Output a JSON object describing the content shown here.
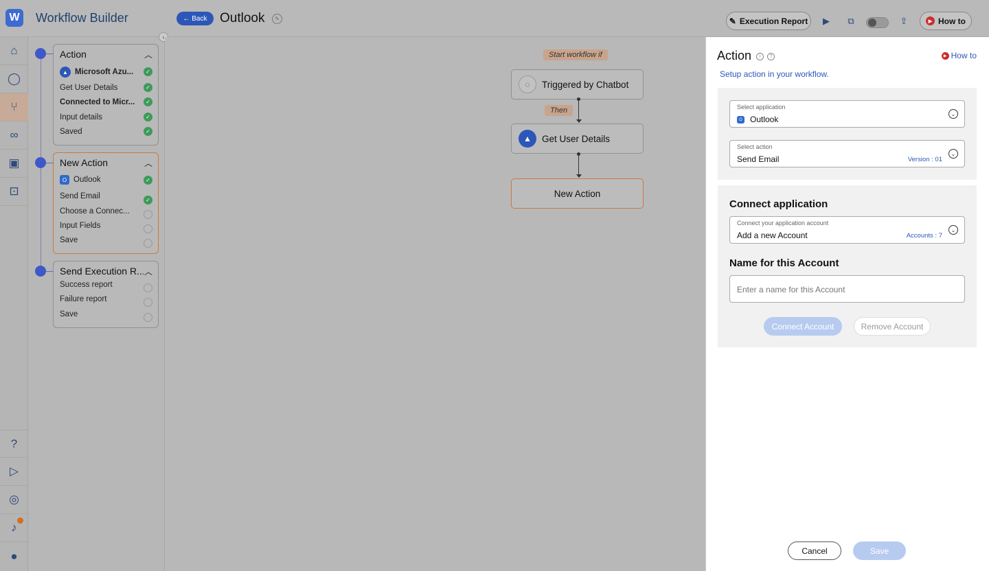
{
  "header": {
    "app_title": "Workflow Builder",
    "back_label": "← Back",
    "workflow_name": "Outlook",
    "exec_report_label": "Execution Report",
    "howto_label": "How to"
  },
  "rail": {
    "items": [
      "home-icon",
      "chat-icon",
      "workflow-icon",
      "link-icon",
      "monitor-icon",
      "lock-icon",
      "help-icon",
      "video-icon",
      "globe-icon",
      "bell-icon",
      "user-icon"
    ]
  },
  "steps": {
    "action": {
      "title": "Action",
      "app": "Microsoft Azu...",
      "rows": [
        "Get User Details",
        "Connected to Micr...",
        "Input details",
        "Saved"
      ]
    },
    "new_action": {
      "title": "New Action",
      "app": "Outlook",
      "rows": [
        "Send Email",
        "Choose a Connec...",
        "Input Fields",
        "Save"
      ]
    },
    "send_report": {
      "title": "Send Execution R...",
      "rows": [
        "Success report",
        "Failure report",
        "Save"
      ]
    }
  },
  "canvas": {
    "start_tag": "Start workflow if",
    "trigger_node": "Triggered by Chatbot",
    "then_tag": "Then",
    "action_node": "Get User Details",
    "new_node": "New Action"
  },
  "panel": {
    "title": "Action",
    "howto": "How to",
    "subtitle": "Setup action in your workflow.",
    "select_app_label": "Select application",
    "select_app_value": "Outlook",
    "select_action_label": "Select action",
    "select_action_value": "Send Email",
    "version": "Version : 01",
    "connect_heading": "Connect application",
    "account_label": "Connect your application account",
    "account_value": "Add a new Account",
    "accounts_count": "Accounts : 7",
    "name_heading": "Name for this Account",
    "name_placeholder": "Enter a name for this Account",
    "connect_btn": "Connect Account",
    "remove_btn": "Remove Account",
    "cancel_btn": "Cancel",
    "save_btn": "Save"
  },
  "colors": {
    "accent": "#2c57b8",
    "success": "#3e9a5a",
    "current_step": "#c87a40"
  }
}
